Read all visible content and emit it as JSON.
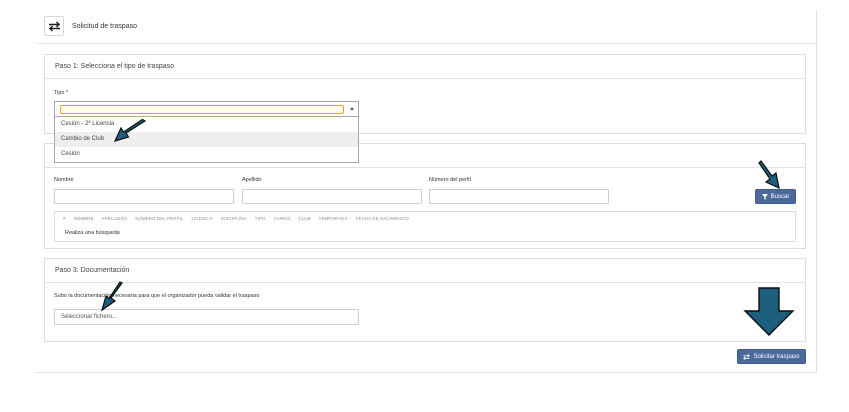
{
  "header": {
    "title": "Solicitud de traspaso",
    "icon": "swap-arrows-icon"
  },
  "step1": {
    "title": "Paso 1: Selecciona el tipo de traspaso",
    "type_label": "Tipo *",
    "type_value": "",
    "options": [
      "Cesión - 2ª Licencia",
      "Cambio de Club",
      "Cesión"
    ],
    "highlighted_option": "Cambio de Club"
  },
  "step2": {
    "name_label": "Nombre",
    "surname_label": "Apellido",
    "profile_label": "Número del perfil",
    "search_button": "Buscar",
    "table_columns": [
      "#",
      "NOMBRE",
      "APELLIDOS",
      "NÚMERO DEL PERFIL",
      "LICENCIA",
      "DISCIPLINA",
      "TIPO",
      "CARGO",
      "CLUB",
      "TEMPORADA",
      "FECHA DE NACIMIENTO"
    ],
    "empty_text": "Realiza una búsqueda"
  },
  "step3": {
    "title": "Paso 3: Documentación",
    "description": "Subo la documentación necesaria para que el organizador pueda validar el traspaso",
    "file_placeholder": "Seleccionar fichero..."
  },
  "submit_button": "Solicitar traspaso",
  "colors": {
    "primary": "#4a6a9c",
    "annotation_arrow": "#1d5e7c",
    "focus": "#e3a11c"
  }
}
